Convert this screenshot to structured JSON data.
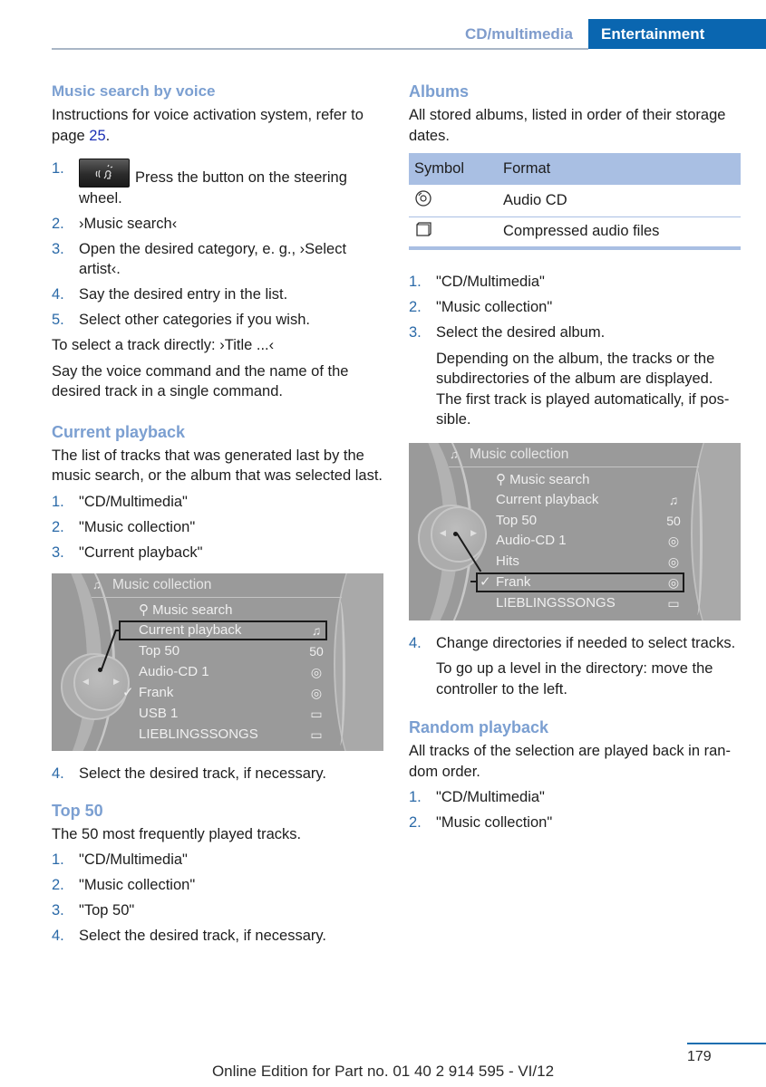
{
  "header": {
    "section": "CD/multimedia",
    "chapter": "Entertainment",
    "colors": {
      "chapter_bg": "#0a66b0",
      "section_text": "#7f9ccc",
      "heading": "#7b9fd1",
      "step_number": "#2b6aa8",
      "table_header": "#a9bfe3"
    }
  },
  "left": {
    "voice": {
      "heading": "Music search by voice",
      "intro_before": "Instructions for voice activation system, refer to page ",
      "intro_link": "25",
      "intro_after": ".",
      "button_icon": "voice-command-button-icon",
      "steps": [
        {
          "num": "1.",
          "text": "Press the button on the steering wheel."
        },
        {
          "num": "2.",
          "text": "›Music search‹"
        },
        {
          "num": "3.",
          "text": "Open the desired category, e. g., ›Select artist‹."
        },
        {
          "num": "4.",
          "text": "Say the desired entry in the list."
        },
        {
          "num": "5.",
          "text": "Select other categories if you wish."
        }
      ],
      "direct": "To select a track directly: ›Title ...‹",
      "direct_note": "Say the voice command and the name of the desired track in a single command."
    },
    "current": {
      "heading": "Current playback",
      "intro": "The list of tracks that was generated last by the music search, or the album that was selected last.",
      "steps": [
        {
          "num": "1.",
          "text": "\"CD/Multimedia\""
        },
        {
          "num": "2.",
          "text": "\"Music collection\""
        },
        {
          "num": "3.",
          "text": "\"Current playback\""
        }
      ],
      "screen": {
        "title": "Music collection",
        "rows": [
          {
            "label": "Music search",
            "icon": "",
            "prefix": "search"
          },
          {
            "label": "Current playback",
            "icon": "playlist"
          },
          {
            "label": "Top 50",
            "icon": "50"
          },
          {
            "label": "Audio-CD 1",
            "icon": "cd"
          },
          {
            "label": "Frank",
            "icon": "cd",
            "checked": true
          },
          {
            "label": "USB 1",
            "icon": "folder"
          },
          {
            "label": "LIEBLINGSSONGS",
            "icon": "folder"
          }
        ],
        "highlighted": "Current playback"
      },
      "after_step": {
        "num": "4.",
        "text": "Select the desired track, if necessary."
      }
    },
    "top50": {
      "heading": "Top 50",
      "intro": "The 50 most frequently played tracks.",
      "steps": [
        {
          "num": "1.",
          "text": "\"CD/Multimedia\""
        },
        {
          "num": "2.",
          "text": "\"Music collection\""
        },
        {
          "num": "3.",
          "text": "\"Top 50\""
        },
        {
          "num": "4.",
          "text": "Select the desired track, if necessary."
        }
      ]
    }
  },
  "right": {
    "albums": {
      "heading": "Albums",
      "intro": "All stored albums, listed in order of their storage dates.",
      "table": {
        "headers": [
          "Symbol",
          "Format"
        ],
        "rows": [
          {
            "symbol": "cd-icon",
            "format": "Audio CD"
          },
          {
            "symbol": "folder-icon",
            "format": "Compressed audio files"
          }
        ]
      },
      "steps": [
        {
          "num": "1.",
          "text": "\"CD/Multimedia\""
        },
        {
          "num": "2.",
          "text": "\"Music collection\""
        },
        {
          "num": "3.",
          "text": "Select the desired album.",
          "sub": "Depending on the album, the tracks or the subdirectories of the album are displayed. The first track is played automatically, if pos­sible."
        }
      ],
      "screen": {
        "title": "Music collection",
        "rows": [
          {
            "label": "Music search",
            "icon": "",
            "prefix": "search"
          },
          {
            "label": "Current playback",
            "icon": "playlist"
          },
          {
            "label": "Top 50",
            "icon": "50"
          },
          {
            "label": "Audio-CD 1",
            "icon": "cd"
          },
          {
            "label": "Hits",
            "icon": "cd"
          },
          {
            "label": "Frank",
            "icon": "cd",
            "checked": true
          },
          {
            "label": "LIEBLINGSSONGS",
            "icon": "folder"
          }
        ],
        "highlighted": "Frank"
      },
      "after_step": {
        "num": "4.",
        "text": "Change directories if needed to select tracks.",
        "sub": "To go up a level in the directory: move the controller to the left."
      }
    },
    "random": {
      "heading": "Random playback",
      "intro": "All tracks of the selection are played back in ran­dom order.",
      "steps": [
        {
          "num": "1.",
          "text": "\"CD/Multimedia\""
        },
        {
          "num": "2.",
          "text": "\"Music collection\""
        }
      ]
    }
  },
  "footer": {
    "page_number": "179",
    "edition": "Online Edition for Part no. 01 40 2 914 595 - VI/12"
  }
}
